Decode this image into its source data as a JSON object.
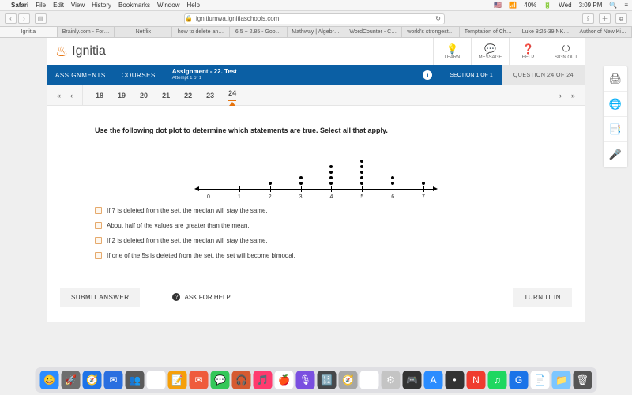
{
  "mac": {
    "app": "Safari",
    "menus": [
      "File",
      "Edit",
      "View",
      "History",
      "Bookmarks",
      "Window",
      "Help"
    ],
    "flag": "🇺🇸",
    "wifi": "40%",
    "day": "Wed",
    "time": "3:09 PM"
  },
  "safari": {
    "url": "ignitiumwa.ignitiaschools.com",
    "tabs": [
      "Ignitia",
      "Brainly.com - For…",
      "Netflix",
      "how to delete an…",
      "6.5 + 2.85 - Goo…",
      "Mathway | Algebr…",
      "WordCounter - C…",
      "world's strongest…",
      "Temptation of Ch…",
      "Luke 8:26-39 NK…",
      "Author of New Ki…"
    ]
  },
  "header": {
    "brand": "Ignitia",
    "cells": [
      {
        "ic": "💡",
        "lbl": "LEARN"
      },
      {
        "ic": "💬",
        "lbl": "MESSAGE"
      },
      {
        "ic": "❓",
        "lbl": "HELP"
      },
      {
        "ic": "⏻",
        "lbl": "SIGN OUT"
      }
    ]
  },
  "blue": {
    "assignments": "ASSIGNMENTS",
    "courses": "COURSES",
    "title": "Assignment  - 22. Test",
    "sub": "Attempt 1 of 1",
    "section": "SECTION 1 OF 1",
    "question": "QUESTION 24 OF 24"
  },
  "qnav": {
    "nums": [
      "18",
      "19",
      "20",
      "21",
      "22",
      "23",
      "24"
    ],
    "active": "24"
  },
  "stem": "Use the following dot plot to determine which statements are true. Select all that apply.",
  "choices": [
    "If 7 is deleted from the set, the median will stay the same.",
    "About half of the values are greater than the mean.",
    "If 2 is deleted from the set, the median will stay the same.",
    "If one of the 5s is deleted from the set, the set will become bimodal."
  ],
  "actions": {
    "submit": "SUBMIT ANSWER",
    "ask": "ASK FOR HELP",
    "turnin": "TURN IT IN"
  },
  "side": [
    "🖨",
    "🌐",
    "📑",
    "🎤"
  ],
  "chart_data": {
    "type": "dotplot",
    "xlabel": "",
    "xticks": [
      0,
      1,
      2,
      3,
      4,
      5,
      6,
      7
    ],
    "counts": {
      "0": 0,
      "1": 0,
      "2": 1,
      "3": 2,
      "4": 4,
      "5": 5,
      "6": 2,
      "7": 1
    },
    "data": [
      2,
      3,
      3,
      4,
      4,
      4,
      4,
      5,
      5,
      5,
      5,
      5,
      6,
      6,
      7
    ]
  },
  "dock": [
    {
      "c": "#2a8cff",
      "t": "😀"
    },
    {
      "c": "#6e6e6e",
      "t": "🚀"
    },
    {
      "c": "#1e73e8",
      "t": "🧭"
    },
    {
      "c": "#2a6fe0",
      "t": "✉"
    },
    {
      "c": "#5a5a5a",
      "t": "👥"
    },
    {
      "c": "#fff",
      "t": "🗓"
    },
    {
      "c": "#f59f0a",
      "t": "📝"
    },
    {
      "c": "#ef5b3c",
      "t": "✉"
    },
    {
      "c": "#34c759",
      "t": "💬"
    },
    {
      "c": "#d65a31",
      "t": "🎧"
    },
    {
      "c": "#ff3a6e",
      "t": "🎵"
    },
    {
      "c": "#fff",
      "t": "🍎"
    },
    {
      "c": "#7a4fe0",
      "t": "🎙"
    },
    {
      "c": "#46474a",
      "t": "🔢"
    },
    {
      "c": "#a6a6a6",
      "t": "🧭"
    },
    {
      "c": "#fff",
      "t": "13"
    },
    {
      "c": "#c4c4c4",
      "t": "⚙"
    },
    {
      "c": "#333",
      "t": "🎮"
    },
    {
      "c": "#2a8cff",
      "t": "A"
    },
    {
      "c": "#333",
      "t": "•"
    },
    {
      "c": "#ef3b2f",
      "t": "N"
    },
    {
      "c": "#1ed760",
      "t": "♫"
    },
    {
      "c": "#1a73e8",
      "t": "G"
    },
    {
      "c": "#fff",
      "t": "📄"
    },
    {
      "c": "#7cc6ff",
      "t": "📁"
    },
    {
      "c": "#555",
      "t": "🗑"
    }
  ]
}
